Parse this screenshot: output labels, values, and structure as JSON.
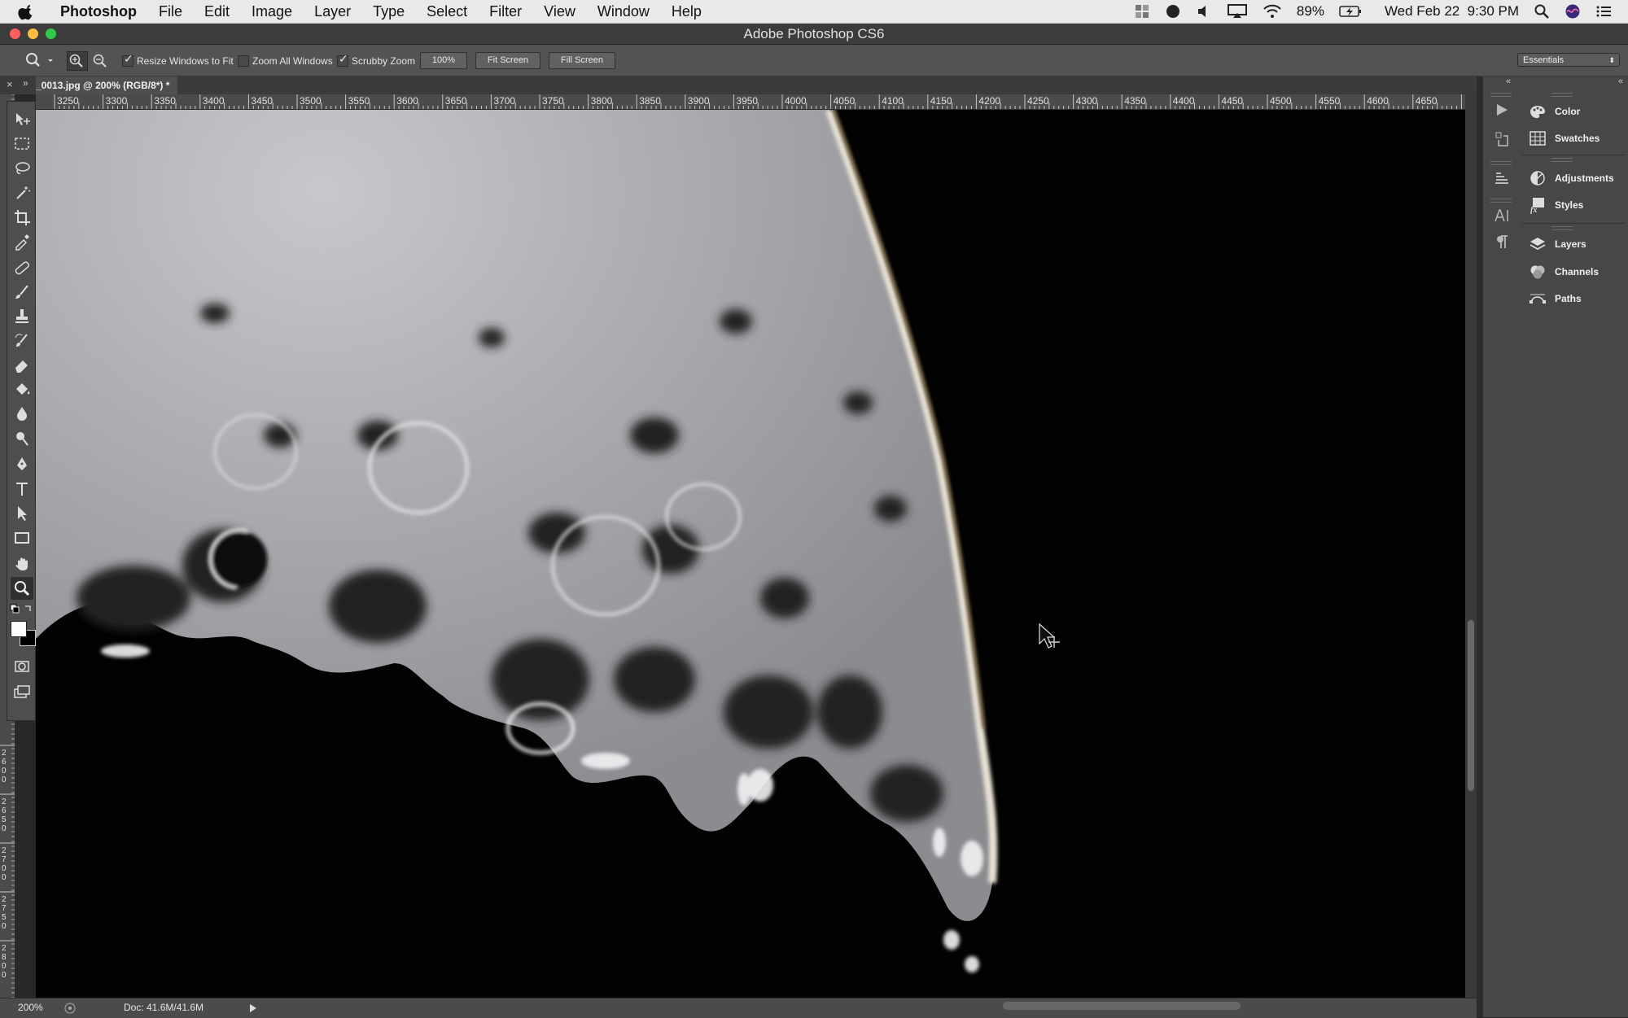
{
  "menubar": {
    "app_name": "Photoshop",
    "menus": [
      "File",
      "Edit",
      "Image",
      "Layer",
      "Type",
      "Select",
      "Filter",
      "View",
      "Window",
      "Help"
    ],
    "battery": "89%",
    "datetime": "Wed Feb 22  9:30 PM"
  },
  "window": {
    "title": "Adobe Photoshop CS6"
  },
  "options_bar": {
    "resize_windows_label": "Resize Windows to Fit",
    "resize_windows_checked": true,
    "zoom_all_label": "Zoom All Windows",
    "zoom_all_checked": false,
    "scrubby_label": "Scrubby Zoom",
    "scrubby_checked": true,
    "btn_100": "100%",
    "btn_fit": "Fit Screen",
    "btn_fill": "Fill Screen",
    "workspace": "Essentials"
  },
  "document": {
    "tab_title": "_0013.jpg @ 200% (RGB/8*) *"
  },
  "rulers": {
    "horizontal": [
      "3250",
      "3300",
      "3350",
      "3400",
      "3450",
      "3500",
      "3550",
      "3600",
      "3650",
      "3700",
      "3750",
      "3800",
      "3850",
      "3900",
      "3950",
      "4000",
      "4050",
      "4100",
      "4150",
      "4200",
      "4250",
      "4300",
      "4350",
      "4400",
      "4450",
      "4500",
      "4550",
      "4600",
      "4650"
    ],
    "vertical": [
      "2600",
      "2650",
      "2700",
      "2750",
      "2800"
    ]
  },
  "panels": [
    {
      "label": "Color",
      "icon": "color-wheel-icon"
    },
    {
      "label": "Swatches",
      "icon": "swatches-grid-icon"
    },
    {
      "label": "Adjustments",
      "icon": "adjustments-icon"
    },
    {
      "label": "Styles",
      "icon": "styles-fx-icon"
    },
    {
      "label": "Layers",
      "icon": "layers-stack-icon"
    },
    {
      "label": "Channels",
      "icon": "channels-icon"
    },
    {
      "label": "Paths",
      "icon": "paths-icon"
    }
  ],
  "status": {
    "zoom": "200%",
    "doc_size": "Doc: 41.6M/41.6M"
  },
  "colors": {
    "background": "#282828",
    "panel": "#474747",
    "canvas": "#020202"
  }
}
